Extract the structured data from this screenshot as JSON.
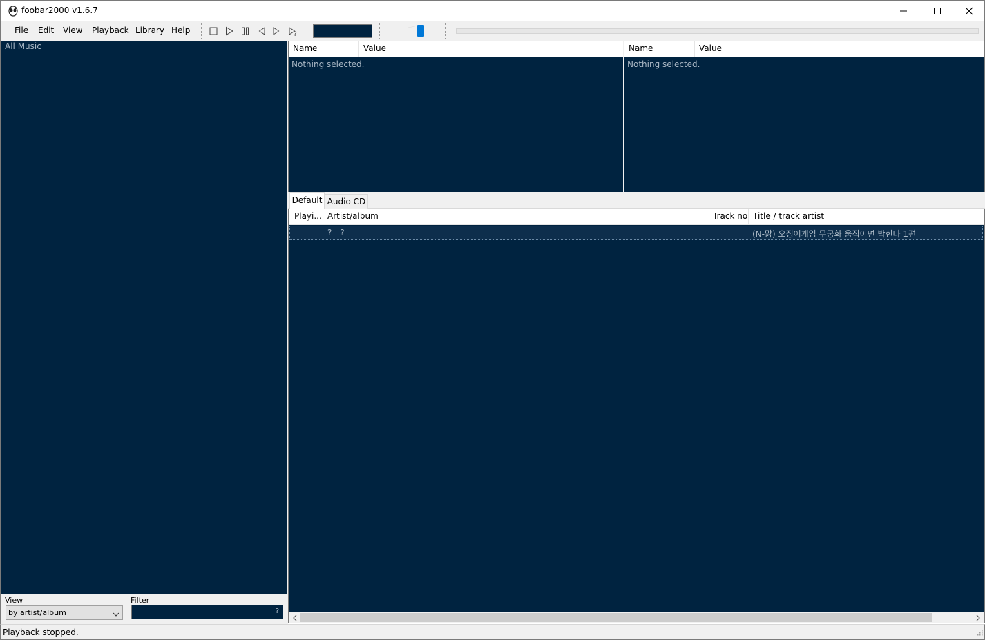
{
  "window": {
    "title": "foobar2000 v1.6.7",
    "icon": "foobar2000-alien-icon"
  },
  "menu": {
    "items": [
      {
        "label": "File"
      },
      {
        "label": "Edit"
      },
      {
        "label": "View"
      },
      {
        "label": "Playback"
      },
      {
        "label": "Library"
      },
      {
        "label": "Help"
      }
    ]
  },
  "transport": {
    "buttons": [
      "stop-icon",
      "play-icon",
      "pause-icon",
      "previous-icon",
      "next-icon",
      "random-icon"
    ]
  },
  "volume": {
    "level": 0.7
  },
  "library": {
    "root": "All Music",
    "view_label": "View",
    "view_value": "by artist/album",
    "filter_label": "Filter",
    "filter_help": "?"
  },
  "properties_left": {
    "columns": [
      "Name",
      "Value"
    ],
    "empty_text": "Nothing selected."
  },
  "properties_right": {
    "columns": [
      "Name",
      "Value"
    ],
    "empty_text": "Nothing selected."
  },
  "playlist_tabs": [
    {
      "label": "Default",
      "active": true
    },
    {
      "label": "Audio CD",
      "active": false
    }
  ],
  "playlist": {
    "columns": [
      "Playi...",
      "Artist/album",
      "Track no",
      "Title / track artist"
    ],
    "rows": [
      {
        "playing": "",
        "artist_album": "? - ?",
        "track_no": "",
        "title": "(N-맑) 오징어게임 무궁화 움직이면 박힌다 1편"
      }
    ]
  },
  "status": {
    "text": "Playback stopped."
  },
  "colors": {
    "panel_bg": "#002340",
    "panel_text": "#a9b7c4",
    "accent": "#0078d7"
  }
}
